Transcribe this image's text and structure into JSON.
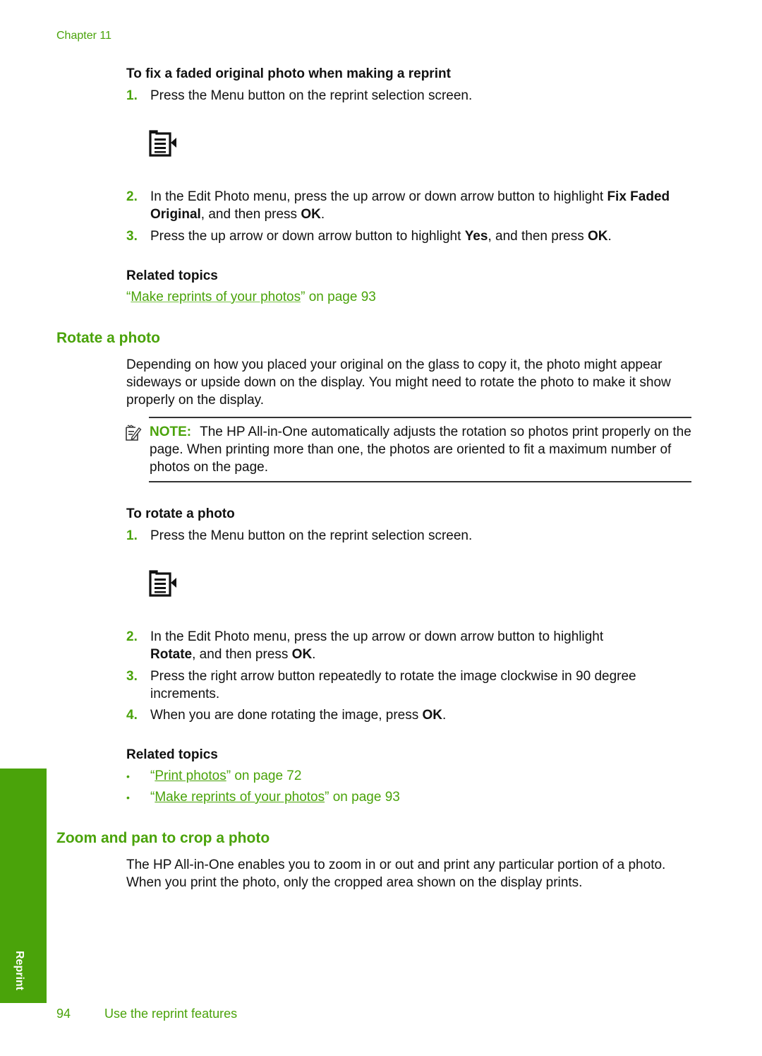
{
  "header": {
    "chapter": "Chapter 11"
  },
  "fix_faded": {
    "title": "To fix a faded original photo when making a reprint",
    "steps": [
      {
        "num": "1.",
        "text": "Press the Menu button on the reprint selection screen."
      },
      {
        "num": "2.",
        "pre": "In the Edit Photo menu, press the up arrow or down arrow button to highlight ",
        "bold1": "Fix Faded Original",
        "mid": ", and then press ",
        "bold2": "OK",
        "post": "."
      },
      {
        "num": "3.",
        "pre": "Press the up arrow or down arrow button to highlight ",
        "bold1": "Yes",
        "mid": ", and then press ",
        "bold2": "OK",
        "post": "."
      }
    ],
    "icon": "menu-button-icon",
    "related_title": "Related topics",
    "related": [
      {
        "open_quote": "“",
        "link": "Make reprints of your photos",
        "close": "” on page 93"
      }
    ]
  },
  "rotate": {
    "heading": "Rotate a photo",
    "intro": "Depending on how you placed your original on the glass to copy it, the photo might appear sideways or upside down on the display. You might need to rotate the photo to make it show properly on the display.",
    "note": {
      "icon": "note-pencil-icon",
      "label": "NOTE:",
      "text": "The HP All-in-One automatically adjusts the rotation so photos print properly on the page. When printing more than one, the photos are oriented to fit a maximum number of photos on the page."
    },
    "proc_title": "To rotate a photo",
    "steps": [
      {
        "num": "1.",
        "text": "Press the Menu button on the reprint selection screen."
      },
      {
        "num": "2.",
        "pre": "In the Edit Photo menu, press the up arrow or down arrow button to highlight ",
        "bold1": "Rotate",
        "mid": ", and then press ",
        "bold2": "OK",
        "post": "."
      },
      {
        "num": "3.",
        "text": "Press the right arrow button repeatedly to rotate the image clockwise in 90 degree increments."
      },
      {
        "num": "4.",
        "pre": "When you are done rotating the image, press ",
        "bold1": "OK",
        "post": "."
      }
    ],
    "icon": "menu-button-icon",
    "related_title": "Related topics",
    "related": [
      {
        "bullet": "•",
        "open_quote": "“",
        "link": "Print photos",
        "close": "” on page 72"
      },
      {
        "bullet": "•",
        "open_quote": "“",
        "link": "Make reprints of your photos",
        "close": "” on page 93"
      }
    ]
  },
  "zoom_pan": {
    "heading": "Zoom and pan to crop a photo",
    "intro": "The HP All-in-One enables you to zoom in or out and print any particular portion of a photo. When you print the photo, only the cropped area shown on the display prints."
  },
  "side_tab": {
    "label": "Reprint",
    "color": "#4aa30a"
  },
  "footer": {
    "page_number": "94",
    "section_title": "Use the reprint features"
  },
  "colors": {
    "accent": "#4aa30a",
    "text": "#111111",
    "rule": "#333333"
  }
}
